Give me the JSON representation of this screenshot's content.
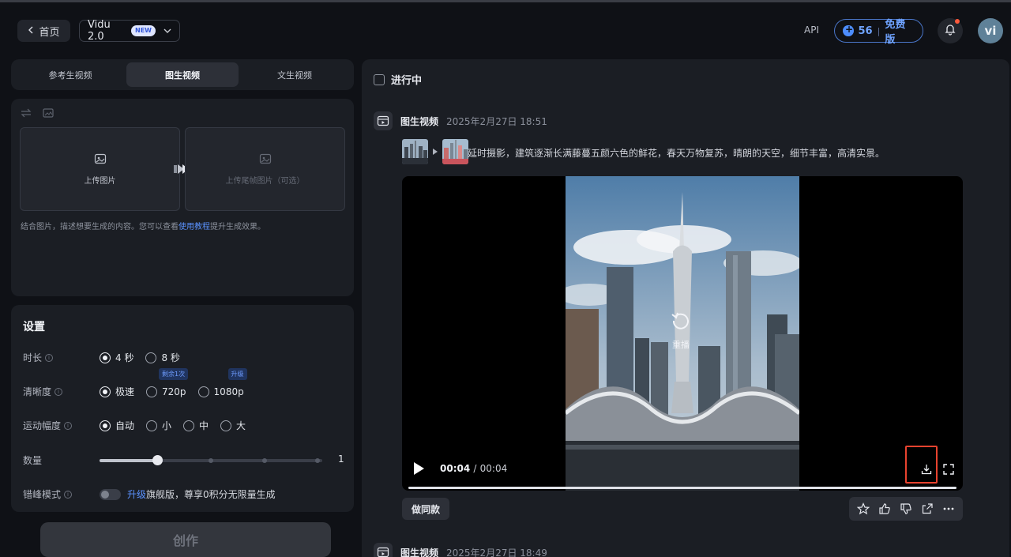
{
  "header": {
    "home_label": "首页",
    "model_name": "Vidu 2.0",
    "model_badge": "NEW",
    "api_label": "API",
    "credits_count": "56",
    "plan_label": "免费版",
    "avatar_initials": "vi"
  },
  "left": {
    "tabs": [
      {
        "label": "参考生视频",
        "active": false
      },
      {
        "label": "图生视频",
        "active": true
      },
      {
        "label": "文生视频",
        "active": false
      }
    ],
    "upload": {
      "upload_label": "上传图片",
      "upload_end_label": "上传尾帧图片（可选）",
      "hint_prefix": "结合图片，描述想要生成的内容。您可以查看",
      "hint_link": "使用教程",
      "hint_suffix": "提升生成效果。"
    },
    "settings": {
      "title": "设置",
      "duration": {
        "label": "时长",
        "options": [
          "4 秒",
          "8 秒"
        ],
        "selected": "4 秒"
      },
      "resolution": {
        "label": "清晰度",
        "options": [
          "极速",
          "720p",
          "1080p"
        ],
        "selected": "极速",
        "tag_720p": "剩余1次",
        "tag_1080p": "升级"
      },
      "motion": {
        "label": "运动幅度",
        "options": [
          "自动",
          "小",
          "中",
          "大"
        ],
        "selected": "自动"
      },
      "quantity": {
        "label": "数量",
        "value": "1",
        "level": 0.26
      },
      "offpeak": {
        "label": "错峰模式",
        "link": "升级",
        "text": "旗舰版，尊享0积分无限量生成"
      }
    },
    "create_label": "创作"
  },
  "right": {
    "in_progress_label": "进行中",
    "entries": [
      {
        "type": "图生视频",
        "time": "2025年2月27日 18:51",
        "prompt": "延时摄影，建筑逐渐长满藤蔓五颜六色的鲜花，春天万物复苏，晴朗的天空，细节丰富，高清实景。"
      },
      {
        "type": "图生视频",
        "time": "2025年2月27日 18:49"
      }
    ],
    "player": {
      "replay_label": "重播",
      "current_time": "00:04",
      "separator": "/",
      "total_time": "00:04",
      "progress": 1.0
    },
    "same_button_label": "做同款"
  },
  "colors": {
    "accent": "#5b93ff",
    "highlight_box": "#e8432f",
    "panel": "#1b1e24",
    "background": "#0f1116"
  }
}
